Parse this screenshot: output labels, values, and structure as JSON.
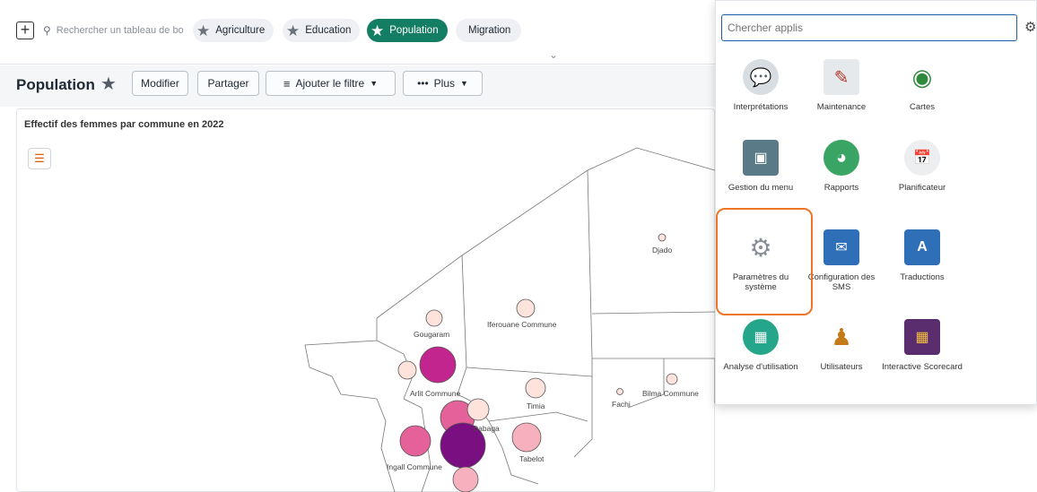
{
  "header": {
    "add_label": "+",
    "search_placeholder": "Rechercher un tableau de bo",
    "chips": [
      {
        "label": "Agriculture",
        "active": false
      },
      {
        "label": "Education",
        "active": false
      },
      {
        "label": "Population",
        "active": true
      },
      {
        "label": "Migration",
        "active": false
      }
    ]
  },
  "dashboard": {
    "title": "Population",
    "buttons": {
      "edit": "Modifier",
      "share": "Partager",
      "filter": "Ajouter le filtre",
      "more": "Plus"
    }
  },
  "map": {
    "title": "Effectif des femmes par commune en 2022",
    "labels": [
      "Djado",
      "Gougaram",
      "Iferouane Commune",
      "Arlit Commune",
      "Timia",
      "Fachi",
      "Bilma Commune",
      "Ingall Commune",
      "Tabelot",
      "Dabaga"
    ]
  },
  "apps_menu": {
    "search_placeholder": "Chercher applis",
    "apps": [
      {
        "label": "Interprétations",
        "icon": "interpretations-icon"
      },
      {
        "label": "Maintenance",
        "icon": "maintenance-icon"
      },
      {
        "label": "Cartes",
        "icon": "maps-icon"
      },
      {
        "label": "Gestion du menu",
        "icon": "menu-management-icon"
      },
      {
        "label": "Rapports",
        "icon": "reports-icon"
      },
      {
        "label": "Planificateur",
        "icon": "scheduler-icon"
      },
      {
        "label": "Paramètres du système",
        "icon": "system-settings-icon"
      },
      {
        "label": "Configuration des SMS",
        "icon": "sms-configuration-icon"
      },
      {
        "label": "Traductions",
        "icon": "translations-icon"
      },
      {
        "label": "Analyse d'utilisation",
        "icon": "usage-analytics-icon"
      },
      {
        "label": "Utilisateurs",
        "icon": "users-icon"
      },
      {
        "label": "Interactive Scorecard",
        "icon": "scorecard-icon"
      }
    ],
    "highlight_color": "#ec7424"
  },
  "colors": {
    "accent": "#147e64",
    "bubble_light": "#fde3dc",
    "bubble_pink": "#e4619a",
    "bubble_magenta": "#c2258e",
    "bubble_purple": "#7a0f82"
  }
}
